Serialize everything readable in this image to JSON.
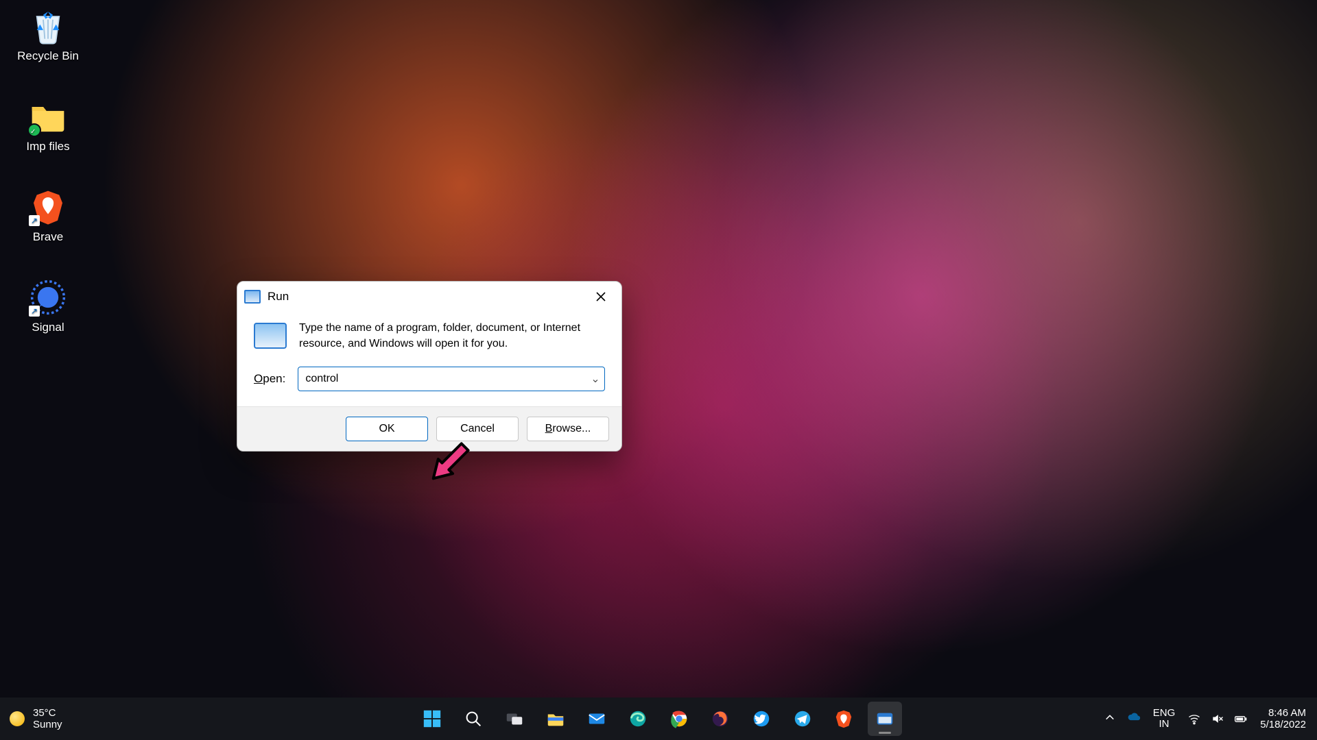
{
  "desktop_icons": [
    {
      "label": "Recycle Bin"
    },
    {
      "label": "Imp files"
    },
    {
      "label": "Brave"
    },
    {
      "label": "Signal"
    }
  ],
  "run_dialog": {
    "title": "Run",
    "message": "Type the name of a program, folder, document, or Internet resource, and Windows will open it for you.",
    "open_label_pre": "O",
    "open_label_post": "pen:",
    "open_value": "control",
    "ok": "OK",
    "cancel": "Cancel",
    "browse_pre": "B",
    "browse_post": "rowse..."
  },
  "taskbar": {
    "weather_temp": "35°C",
    "weather_desc": "Sunny",
    "lang_top": "ENG",
    "lang_bottom": "IN",
    "time": "8:46 AM",
    "date": "5/18/2022"
  }
}
